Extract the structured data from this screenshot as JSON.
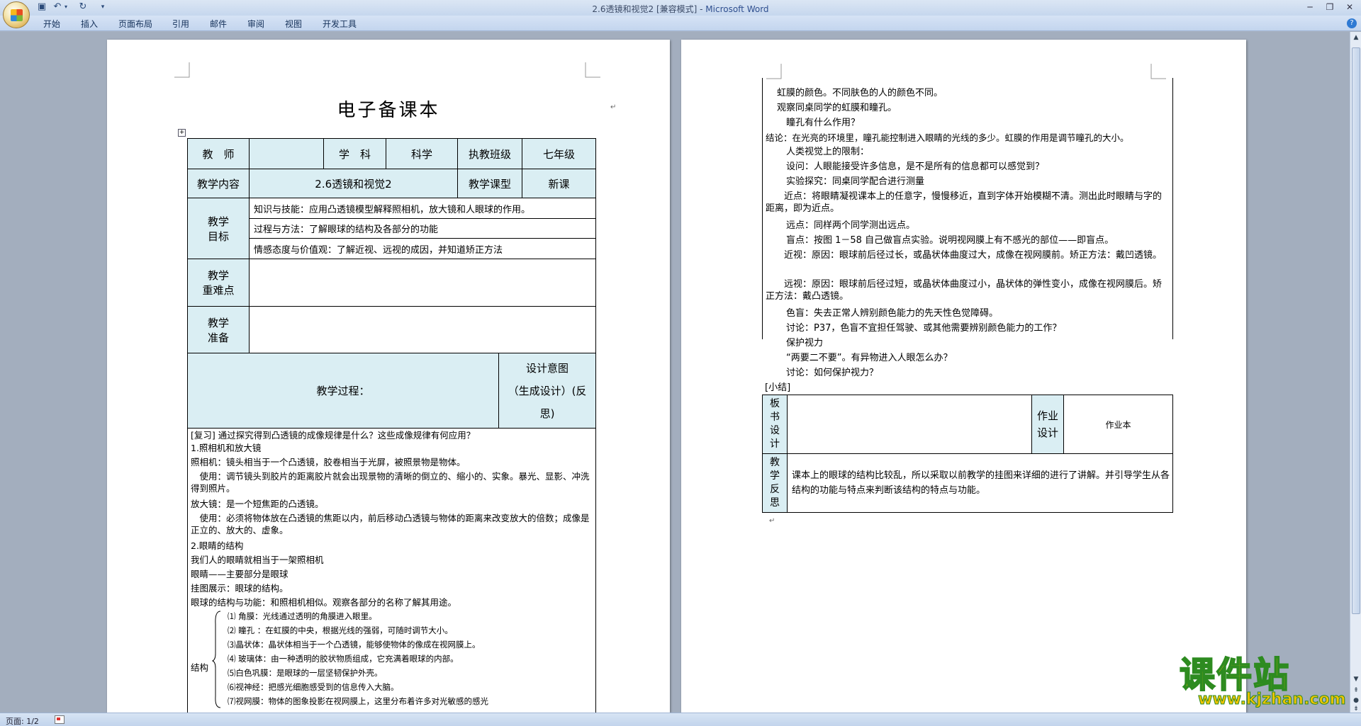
{
  "window": {
    "title_doc": "2.6透镜和视觉2 [兼容模式] - ",
    "title_app": "Microsoft Word"
  },
  "ribbon": {
    "tabs": [
      "开始",
      "插入",
      "页面布局",
      "引用",
      "邮件",
      "审阅",
      "视图",
      "开发工具"
    ],
    "help": "?"
  },
  "page1": {
    "title": "电子备课本",
    "table": {
      "teacher_label": "教　师",
      "teacher_value": "",
      "subject_label": "学　科",
      "subject_value": "科学",
      "class_label": "执教班级",
      "class_value": "七年级",
      "content_label": "教学内容",
      "content_value": "2.6透镜和视觉2",
      "type_label": "教学课型",
      "type_value": "新课",
      "goal_label_1": "教学",
      "goal_label_2": "目标",
      "goal_1": "知识与技能：应用凸透镜模型解释照相机，放大镜和人眼球的作用。",
      "goal_2": "过程与方法：了解眼球的结构及各部分的功能",
      "goal_3": "情感态度与价值观：了解近视、远视的成因，并知道矫正方法",
      "key_label_1": "教学",
      "key_label_2": "重难点",
      "prep_label_1": "教学",
      "prep_label_2": "准备",
      "process_label": "教学过程：",
      "design_1": "设计意图",
      "design_2": "（生成设计）(反",
      "design_3": "思)"
    },
    "body": [
      "[复习]  通过探究得到凸透镜的成像规律是什么？这些成像规律有何应用？",
      "1.照相机和放大镜",
      "照相机：镜头相当于一个凸透镜，胶卷相当于光屏，被照景物是物体。",
      "　使用：调节镜头到胶片的距离胶片就会出现景物的清晰的倒立的、缩小的、实象。暴光、显影、冲洗得到照片。",
      "放大镜：是一个短焦距的凸透镜。",
      "　使用：必须将物体放在凸透镜的焦距以内，前后移动凸透镜与物体的距离来改变放大的倍数；成像是正立的、放大的、虚象。",
      "2.眼睛的结构",
      "我们人的眼睛就相当于一架照相机",
      "眼睛——主要部分是眼球",
      "挂图展示：眼球的结构。",
      "眼球的结构与功能：和照相机相似。观察各部分的名称了解其用途。"
    ],
    "structure_label": "结构",
    "structure": [
      "⑴ 角膜：光线通过透明的角膜进入眼里。",
      "⑵ 瞳孔 ：在虹膜的中央，根据光线的强弱，可随时调节大小。",
      "⑶晶状体：晶状体相当于一个凸透镜，能够使物体的像成在视网膜上。",
      "⑷ 玻璃体：由一种透明的胶状物质组成，它充满着眼球的内部。",
      "⑸白色巩膜：是眼球的一层坚韧保护外壳。",
      "⑹视神经：把感光细胞感受到的信息传入大脑。",
      "⑺视网膜：物体的图象投影在视网膜上，这里分布着许多对光敏感的感光"
    ]
  },
  "page2": {
    "lines": [
      "　虹膜的颜色。不同肤色的人的颜色不同。",
      "　观察同桌同学的虹膜和瞳孔。",
      "　　瞳孔有什么作用？",
      "结论：在光亮的环境里，瞳孔能控制进入眼睛的光线的多少。虹膜的作用是调节瞳孔的大小。",
      "　　人类视觉上的限制：",
      "　　设问：人眼能接受许多信息，是不是所有的信息都可以感觉到？",
      "　　实验探究：同桌同学配合进行测量",
      "　　近点：将眼睛凝视课本上的任意字，慢慢移近，直到字体开始模糊不清。测出此时眼睛与字的距离，即为近点。",
      "　　远点：同样两个同学测出远点。",
      "　　盲点：按图 1－58 自己做盲点实验。说明视网膜上有不感光的部位——即盲点。",
      "　　近视：原因：眼球前后径过长，或晶状体曲度过大，成像在视网膜前。矫正方法：戴凹透镜。",
      "　　远视：原因：眼球前后径过短，或晶状体曲度过小，晶状体的弹性变小，成像在视网膜后。矫正方法：戴凸透镜。",
      "　　色盲：失去正常人辨别颜色能力的先天性色觉障碍。",
      "　　讨论：P37，色盲不宜担任驾驶、或其他需要辨别颜色能力的工作？",
      "　　保护视力",
      "　　“两要二不要”。有异物进入人眼怎么办？",
      "　　讨论：如何保护视力？",
      "[小结]"
    ],
    "board_label": [
      "板",
      "书",
      "设",
      "计"
    ],
    "homework_label_1": "作业",
    "homework_label_2": "设计",
    "homework_value": "作业本",
    "reflect_label": [
      "教",
      "学",
      "反",
      "思"
    ],
    "reflect_text": "课本上的眼球的结构比较乱，所以采取以前教学的挂图来详细的进行了讲解。并引导学生从各结构的功能与特点来判断该结构的特点与功能。"
  },
  "status": {
    "page": "页面: 1/2"
  },
  "watermark": {
    "main": "课件站",
    "url": "www.kjzhan.com"
  }
}
